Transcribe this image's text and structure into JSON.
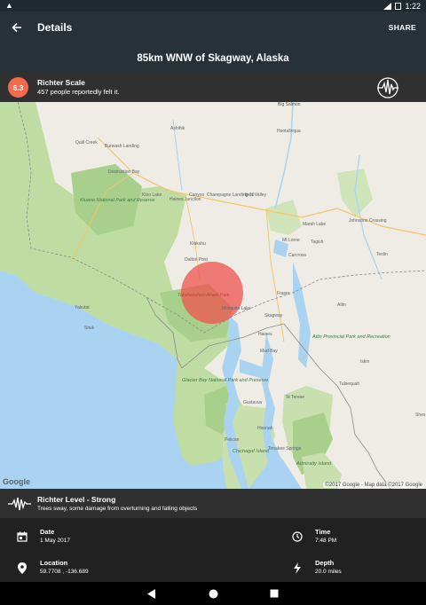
{
  "status_bar": {
    "time": "1:22"
  },
  "app_bar": {
    "title": "Details",
    "share_label": "SHARE",
    "back_icon": "arrow-back-icon"
  },
  "place": {
    "title": "85km WNW of Skagway, Alaska"
  },
  "magnitude": {
    "value": "6.3",
    "scale_label": "Richter Scale",
    "felt_text": "457 people reportedly felt it.",
    "badge_color": "#f26b4d",
    "icon": "seismograph-icon"
  },
  "map": {
    "labels": [
      "Big Salmon",
      "Ashihik",
      "Hootalinqua",
      "Quill Creek",
      "Burwash Landing",
      "Destruction Bay",
      "Kloo Lake",
      "Haines Junction",
      "Canyon",
      "Champagne Landing 10",
      "Ibex Valley",
      "Kluane National Park and Reserve",
      "Marsh Lake",
      "Johnsons Crossing",
      "Klukshu",
      "Mt Lorne",
      "Tagish",
      "Carcross",
      "Teslin",
      "Dalton Post",
      "Tatshenshini-Alsek Park",
      "Fraser",
      "Atlin",
      "Mosquito Lake",
      "Skagway",
      "Yakutat",
      "Situk",
      "Haines",
      "Mud Bay",
      "Atlin Provincial Park and Recreation",
      "Glacier Bay National Park and Preserve",
      "Gustavus",
      "St Terese",
      "Tulsequah",
      "Hoonah",
      "Pelican",
      "Chichagof Island",
      "Tenakee Springs",
      "Admiralty Island",
      "Iskin",
      "Shes"
    ],
    "google_logo": "Google",
    "attribution": "©2017 Google - Map data ©2017 Google",
    "epicenter_color": "#ef5350"
  },
  "richter_level": {
    "title": "Richter Level - Strong",
    "description": "Trees sway, some damage from overturning and falling objects",
    "icon": "seismic-wave-icon"
  },
  "details": {
    "date_label": "Date",
    "date_value": "1 May 2017",
    "time_label": "Time",
    "time_value": "7:48 PM",
    "location_label": "Location",
    "location_value": "59.7708 , -136.689",
    "depth_label": "Depth",
    "depth_value": "20.0 miles"
  },
  "nav": {
    "back_icon": "nav-back-icon",
    "home_icon": "nav-home-icon",
    "recents_icon": "nav-recents-icon"
  }
}
